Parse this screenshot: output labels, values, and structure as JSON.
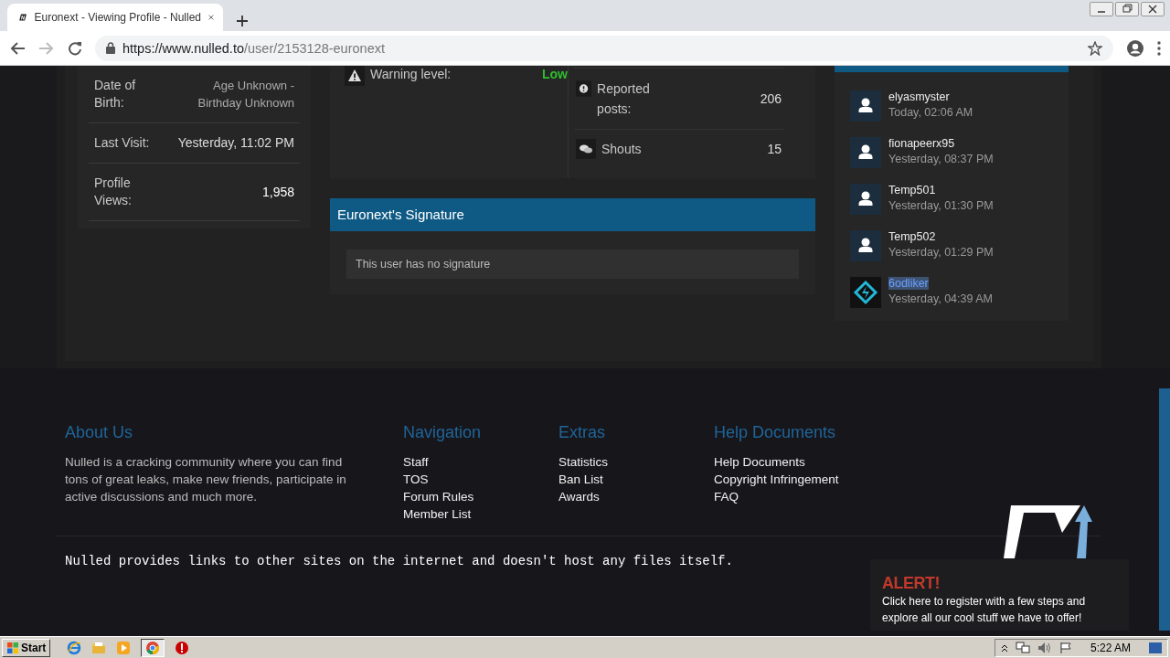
{
  "browser": {
    "tab": {
      "title": "Euronext - Viewing Profile - Nulled"
    },
    "address": {
      "host": "https://www.nulled.to",
      "path": "/user/2153128-euronext"
    }
  },
  "profile_info": [
    {
      "label": "Date of Birth:",
      "value": "Age Unknown - Birthday Unknown",
      "kind": "muted"
    },
    {
      "label": "Last Visit:",
      "value": "Yesterday, 11:02 PM",
      "kind": "normal"
    },
    {
      "label": "Profile Views:",
      "value": "1,958",
      "kind": "strong"
    }
  ],
  "warning": {
    "label": "Warning level:",
    "value": "Low"
  },
  "stats": [
    {
      "kind": "reported",
      "label": "Reported posts:",
      "value": "206"
    },
    {
      "kind": "shouts",
      "label": "Shouts",
      "value": "15"
    }
  ],
  "signature": {
    "title": "Euronext's Signature",
    "text": "This user has no signature"
  },
  "visitors": [
    {
      "name": "elyasmyster",
      "time": "Today, 02:06 AM",
      "kind": "default",
      "selected": false
    },
    {
      "name": "fionapeerx95",
      "time": "Yesterday, 08:37 PM",
      "kind": "default",
      "selected": false
    },
    {
      "name": "Temp501",
      "time": "Yesterday, 01:30 PM",
      "kind": "default",
      "selected": false
    },
    {
      "name": "Temp502",
      "time": "Yesterday, 01:29 PM",
      "kind": "default",
      "selected": false
    },
    {
      "name": "6odliker",
      "time": "Yesterday, 04:39 AM",
      "kind": "logo",
      "selected": true
    }
  ],
  "footer": {
    "about": {
      "title": "About Us",
      "text": "Nulled is a cracking community where you can find tons of great leaks, make new friends, participate in active discussions and much more."
    },
    "columns": [
      {
        "title": "Navigation",
        "links": [
          "Staff",
          "TOS",
          "Forum Rules",
          "Member List"
        ]
      },
      {
        "title": "Extras",
        "links": [
          "Statistics",
          "Ban List",
          "Awards"
        ]
      },
      {
        "title": "Help Documents",
        "links": [
          "Help Documents",
          "Copyright Infringement",
          "FAQ"
        ]
      }
    ],
    "disclaimer": "Nulled provides links to other sites on the internet and doesn't host any files itself.",
    "alert": {
      "title": "ALERT!",
      "text": "Click here to register with a few steps and explore all our cool stuff we have to offer!"
    }
  },
  "taskbar": {
    "start": "Start",
    "time": "5:22 AM"
  }
}
